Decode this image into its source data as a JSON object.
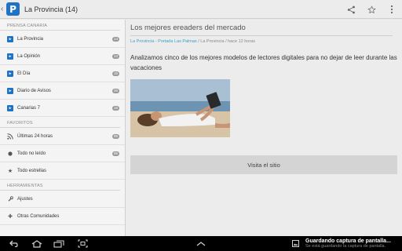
{
  "actionbar": {
    "logo_letter": "P",
    "title": "La Provincia (14)",
    "actions": [
      {
        "icon": "share-icon",
        "glyph": "⋖"
      },
      {
        "icon": "star-outline-icon",
        "glyph": "☆"
      },
      {
        "icon": "overflow-menu-icon",
        "glyph": "⋮"
      }
    ]
  },
  "sidebar": {
    "sections": [
      {
        "header": "PRENSA CANARIA",
        "items": [
          {
            "label": "La Provincia",
            "badge": "14",
            "icon": "feed-icon"
          },
          {
            "label": "La Opinión",
            "badge": "13",
            "icon": "feed-icon"
          },
          {
            "label": "El Día",
            "badge": "15",
            "icon": "feed-icon"
          },
          {
            "label": "Diario de Avisos",
            "badge": "26",
            "icon": "feed-icon"
          },
          {
            "label": "Canarias 7",
            "badge": "15",
            "icon": "feed-icon"
          }
        ]
      },
      {
        "header": "FAVORITOS",
        "items": [
          {
            "label": "Últimas 24 horas",
            "badge": "95",
            "icon": "rss-icon"
          },
          {
            "label": "Todo no leído",
            "badge": "95",
            "icon": "circle-icon"
          },
          {
            "label": "Todo estrellas",
            "badge": "",
            "icon": "star-icon"
          }
        ]
      },
      {
        "header": "HERRAMIENTAS",
        "items": [
          {
            "label": "Ajustes",
            "badge": "",
            "icon": "settings-icon"
          },
          {
            "label": "Otras Comunidades",
            "badge": "",
            "icon": "plus-icon"
          }
        ]
      }
    ]
  },
  "article": {
    "title": "Los mejores ereaders del mercado",
    "source": "La Provincia - Portada Las Palmas",
    "byline": " / La Provincia / hace 12 horas",
    "summary": "Analizamos cinco de los mejores modelos de lectores digitales para no dejar de leer durante las vacaciones",
    "visit_label": "Visita el sitio"
  },
  "notification": {
    "title": "Guardando captura de pantalla...",
    "subtitle": "Se está guardando la captura de pantalla."
  },
  "colors": {
    "accent": "#1f72c4",
    "link": "#3ba0c6",
    "badge": "#9a9a9a"
  }
}
